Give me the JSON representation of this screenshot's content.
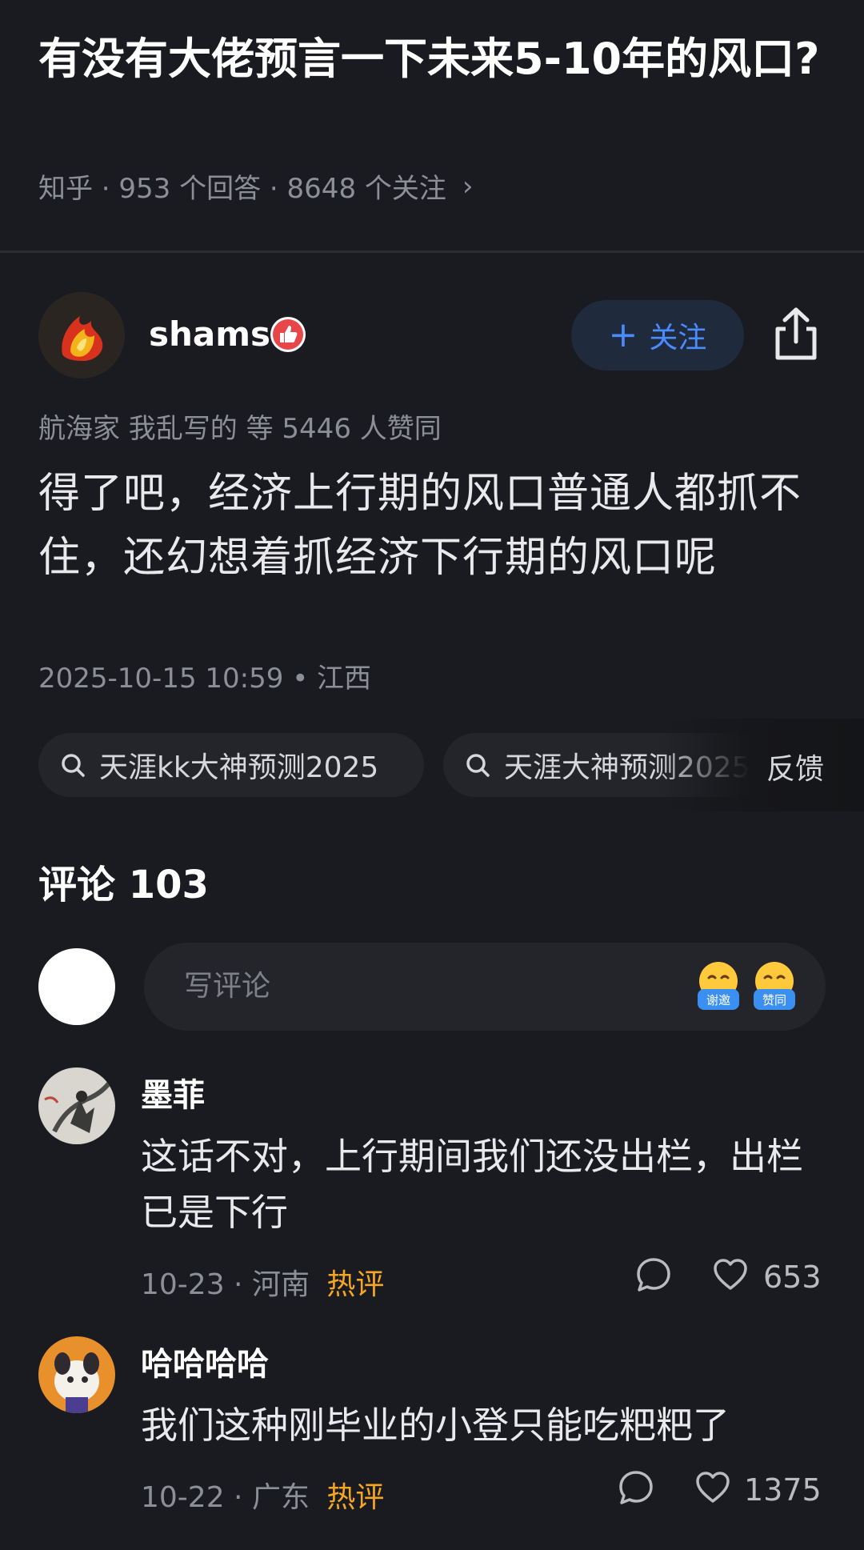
{
  "question": {
    "title": "有没有大佬预言一下未来5-10年的风口?",
    "meta": "知乎 · 953 个回答 · 8648 个关注",
    "chevron": "›"
  },
  "author": {
    "name": "shams",
    "follow_label": "关注",
    "follow_plus": "+"
  },
  "answer": {
    "endorsement": "航海家 我乱写的 等 5446 人赞同",
    "text": "得了吧，经济上行期的风口普通人都抓不住，还幻想着抓经济下行期的风口呢",
    "time_location": "2025-10-15 10:59 • 江西"
  },
  "search_chips": [
    {
      "label": "天涯kk大神预测2025"
    },
    {
      "label": "天涯大神预测2025"
    }
  ],
  "feedback_label": "反馈",
  "comments": {
    "title": "评论 103",
    "input_placeholder": "写评论",
    "emojis": [
      {
        "name": "thanks-emoji",
        "label": "谢邀",
        "color": "#3b8ff0"
      },
      {
        "name": "agree-emoji",
        "label": "赞同",
        "color": "#3b8ff0"
      }
    ],
    "items": [
      {
        "user": "墨菲",
        "text": "这话不对，上行期间我们还没出栏，出栏已是下行",
        "meta": "10-23 · 河南",
        "hot": "热评",
        "likes": "653"
      },
      {
        "user": "哈哈哈哈",
        "text": "我们这种刚毕业的小登只能吃粑粑了",
        "meta": "10-22 · 广东",
        "hot": "热评",
        "likes": "1375"
      }
    ]
  },
  "colors": {
    "background": "#1a1b20",
    "accent_blue": "#4a8cff",
    "hot_orange": "#f5a623",
    "muted_text": "#8d8f97"
  }
}
